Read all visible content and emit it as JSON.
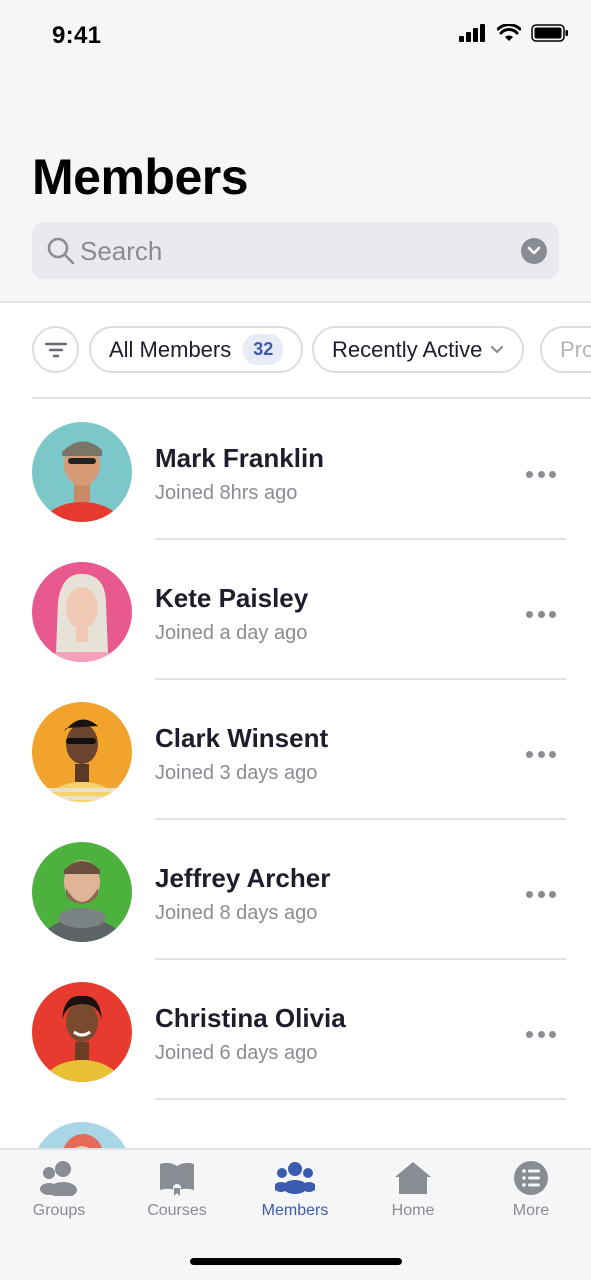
{
  "status_bar": {
    "time": "9:41",
    "icons": [
      "signal-icon",
      "wifi-icon",
      "battery-icon"
    ]
  },
  "header": {
    "title": "Members"
  },
  "search": {
    "placeholder": "Search"
  },
  "filters": {
    "chips": [
      {
        "label": "All Members",
        "count": "32"
      },
      {
        "label": "Recently Active"
      },
      {
        "label": "Pro"
      }
    ]
  },
  "members": [
    {
      "name": "Mark Franklin",
      "joined": "Joined 8hrs ago",
      "avatar_color": "#7cc7c9"
    },
    {
      "name": "Kete Paisley",
      "joined": "Joined a day ago",
      "avatar_color": "#e85a8e"
    },
    {
      "name": "Clark Winsent",
      "joined": "Joined 3 days ago",
      "avatar_color": "#f2a32c"
    },
    {
      "name": "Jeffrey Archer",
      "joined": "Joined 8 days ago",
      "avatar_color": "#4db23d"
    },
    {
      "name": "Christina Olivia",
      "joined": "Joined 6 days ago",
      "avatar_color": "#e63b2e"
    }
  ],
  "tabs": [
    {
      "label": "Groups",
      "icon": "groups-icon",
      "active": false
    },
    {
      "label": "Courses",
      "icon": "courses-icon",
      "active": false
    },
    {
      "label": "Members",
      "icon": "members-icon",
      "active": true
    },
    {
      "label": "Home",
      "icon": "home-icon",
      "active": false
    },
    {
      "label": "More",
      "icon": "more-list-icon",
      "active": false
    }
  ],
  "colors": {
    "accent": "#3b5bb0",
    "muted": "#8a8c93",
    "background": "#f5f6f8"
  }
}
